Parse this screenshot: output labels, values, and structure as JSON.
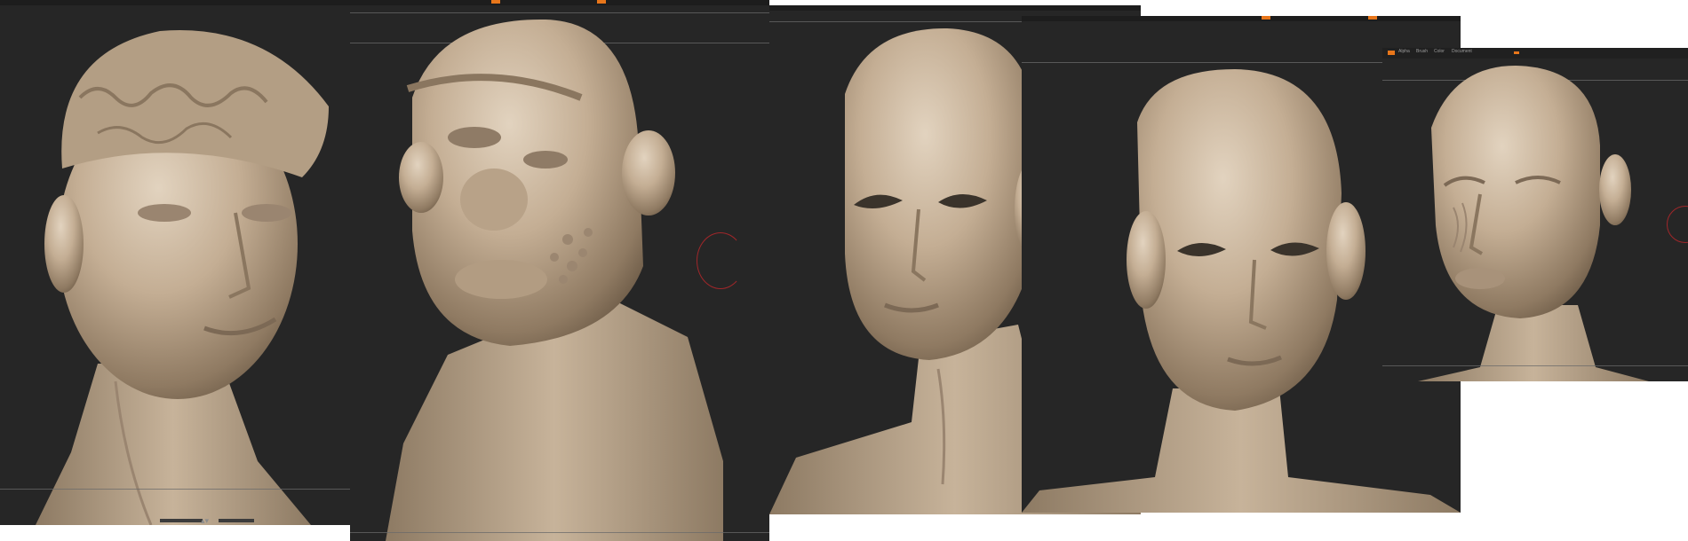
{
  "figure": {
    "panels": [
      {
        "id": "bust-1",
        "subject": "wrinkled bust with wavy hair"
      },
      {
        "id": "bust-2",
        "subject": "bust with broad nose and textured cheek"
      },
      {
        "id": "bust-3",
        "subject": "smooth bald female head"
      },
      {
        "id": "bust-4",
        "subject": "smooth bald head with large eyes"
      },
      {
        "id": "bust-5",
        "subject": "bald head with wrinkled face"
      }
    ]
  },
  "viewport5_menu": {
    "items": [
      "Alpha",
      "Brush",
      "Color",
      "Document"
    ]
  },
  "colors": {
    "viewport_bg": "#262626",
    "clay": "#c2ad93",
    "accent": "#e8761a",
    "ring": "#a0272a"
  },
  "icons": {
    "nav": "up-down-arrows-icon",
    "ring": "rotate-gizmo-icon"
  }
}
